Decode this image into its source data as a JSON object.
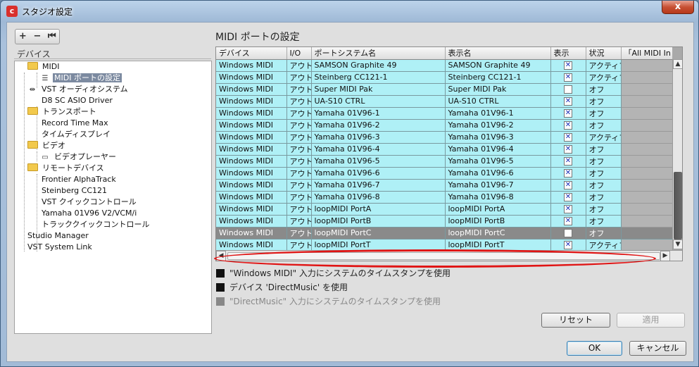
{
  "window": {
    "title": "スタジオ設定",
    "app_icon": "cubase-logo-icon",
    "close_glyph": "x"
  },
  "toolbar": {
    "add": "+",
    "remove": "−",
    "collapse": "⏮"
  },
  "tree": {
    "header": "デバイス",
    "items": [
      {
        "label": "MIDI",
        "icon": "folder-icon",
        "level": 1
      },
      {
        "label": "MIDI ポートの設定",
        "icon": "midi-port-icon",
        "level": 2,
        "selected": true
      },
      {
        "label": "VST オーディオシステム",
        "icon": "vst-audio-icon",
        "level": 1
      },
      {
        "label": "D8 SC ASIO Driver",
        "icon": "none",
        "level": 2
      },
      {
        "label": "トランスポート",
        "icon": "folder-icon",
        "level": 1
      },
      {
        "label": "Record Time Max",
        "icon": "none",
        "level": 2
      },
      {
        "label": "タイムディスプレイ",
        "icon": "none",
        "level": 2
      },
      {
        "label": "ビデオ",
        "icon": "folder-icon",
        "level": 1
      },
      {
        "label": "ビデオプレーヤー",
        "icon": "video-player-icon",
        "level": 2
      },
      {
        "label": "リモートデバイス",
        "icon": "folder-icon",
        "level": 1
      },
      {
        "label": "Frontier AlphaTrack",
        "icon": "none",
        "level": 2
      },
      {
        "label": "Steinberg CC121",
        "icon": "none",
        "level": 2
      },
      {
        "label": "VST クイックコントロール",
        "icon": "none",
        "level": 2
      },
      {
        "label": "Yamaha 01V96 V2/VCM/i",
        "icon": "none",
        "level": 2
      },
      {
        "label": "トラッククイックコントロール",
        "icon": "none",
        "level": 2
      },
      {
        "label": "Studio Manager",
        "icon": "none",
        "level": 0
      },
      {
        "label": "VST System Link",
        "icon": "none",
        "level": 0
      }
    ]
  },
  "panel": {
    "title": "MIDI ポートの設定",
    "columns": [
      "デバイス",
      "I/O",
      "ポートシステム名",
      "表示名",
      "表示",
      "状況",
      "「All MIDI In"
    ],
    "rows": [
      {
        "device": "Windows MIDI",
        "io": "アウト",
        "port": "SAMSON Graphite 49",
        "display": "SAMSON Graphite 49",
        "visible": true,
        "status": "アクティブ"
      },
      {
        "device": "Windows MIDI",
        "io": "アウト",
        "port": "Steinberg CC121-1",
        "display": "Steinberg CC121-1",
        "visible": true,
        "status": "アクティブ"
      },
      {
        "device": "Windows MIDI",
        "io": "アウト",
        "port": "Super MIDI Pak",
        "display": "Super MIDI Pak",
        "visible": false,
        "status": "オフ"
      },
      {
        "device": "Windows MIDI",
        "io": "アウト",
        "port": "UA-S10 CTRL",
        "display": "UA-S10 CTRL",
        "visible": true,
        "status": "オフ"
      },
      {
        "device": "Windows MIDI",
        "io": "アウト",
        "port": "Yamaha 01V96-1",
        "display": "Yamaha 01V96-1",
        "visible": true,
        "status": "オフ"
      },
      {
        "device": "Windows MIDI",
        "io": "アウト",
        "port": "Yamaha 01V96-2",
        "display": "Yamaha 01V96-2",
        "visible": true,
        "status": "オフ"
      },
      {
        "device": "Windows MIDI",
        "io": "アウト",
        "port": "Yamaha 01V96-3",
        "display": "Yamaha 01V96-3",
        "visible": true,
        "status": "アクティブ"
      },
      {
        "device": "Windows MIDI",
        "io": "アウト",
        "port": "Yamaha 01V96-4",
        "display": "Yamaha 01V96-4",
        "visible": true,
        "status": "オフ"
      },
      {
        "device": "Windows MIDI",
        "io": "アウト",
        "port": "Yamaha 01V96-5",
        "display": "Yamaha 01V96-5",
        "visible": true,
        "status": "オフ"
      },
      {
        "device": "Windows MIDI",
        "io": "アウト",
        "port": "Yamaha 01V96-6",
        "display": "Yamaha 01V96-6",
        "visible": true,
        "status": "オフ"
      },
      {
        "device": "Windows MIDI",
        "io": "アウト",
        "port": "Yamaha 01V96-7",
        "display": "Yamaha 01V96-7",
        "visible": true,
        "status": "オフ"
      },
      {
        "device": "Windows MIDI",
        "io": "アウト",
        "port": "Yamaha 01V96-8",
        "display": "Yamaha 01V96-8",
        "visible": true,
        "status": "オフ"
      },
      {
        "device": "Windows MIDI",
        "io": "アウト",
        "port": "loopMIDI PortA",
        "display": "loopMIDI PortA",
        "visible": true,
        "status": "オフ"
      },
      {
        "device": "Windows MIDI",
        "io": "アウト",
        "port": "loopMIDI PortB",
        "display": "loopMIDI PortB",
        "visible": true,
        "status": "オフ"
      },
      {
        "device": "Windows MIDI",
        "io": "アウト",
        "port": "loopMIDI PortC",
        "display": "loopMIDI PortC",
        "visible": false,
        "status": "オフ",
        "highlighted": true
      },
      {
        "device": "Windows MIDI",
        "io": "アウト",
        "port": "loopMIDI PortT",
        "display": "loopMIDI PortT",
        "visible": true,
        "status": "アクティブ"
      }
    ],
    "options": [
      {
        "label": "\"Windows MIDI\" 入力にシステムのタイムスタンプを使用",
        "checked": true,
        "enabled": true
      },
      {
        "label": "デバイス 'DirectMusic' を使用",
        "checked": true,
        "enabled": true
      },
      {
        "label": "\"DirectMusic\" 入力にシステムのタイムスタンプを使用",
        "checked": true,
        "enabled": false
      }
    ],
    "reset_label": "リセット",
    "apply_label": "適用"
  },
  "footer": {
    "ok_label": "OK",
    "cancel_label": "キャンセル"
  },
  "colors": {
    "row_bg": "#aff0f6",
    "highlight_row": "#8a8a8a",
    "annotation": "#e01414",
    "checkmark": "#1a2fb8"
  }
}
